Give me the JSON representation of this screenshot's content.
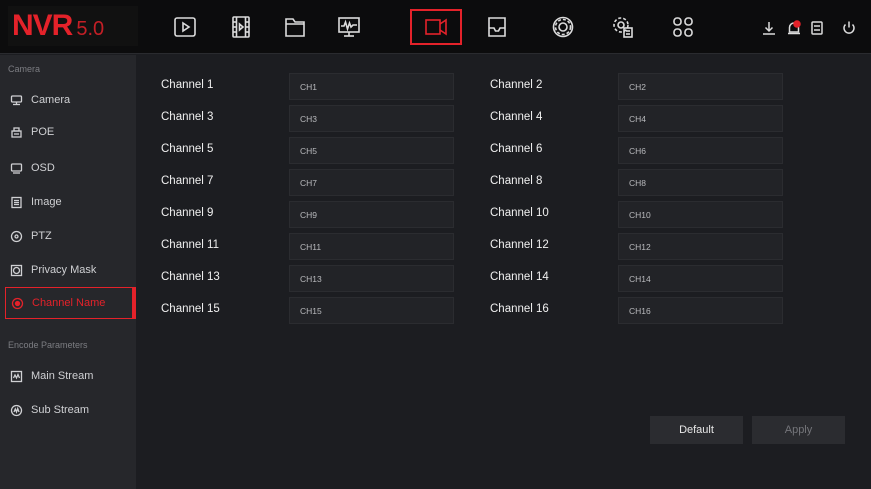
{
  "logo": {
    "brand": "NVR",
    "version": "5.0",
    "accent": "#e4222a"
  },
  "nav": [
    {
      "name": "playback-icon"
    },
    {
      "name": "video-clip-icon"
    },
    {
      "name": "folder-icon"
    },
    {
      "name": "monitor-waveform-icon"
    },
    {
      "name": "camera-icon",
      "active": true
    },
    {
      "name": "storage-icon"
    },
    {
      "name": "settings-icon"
    },
    {
      "name": "advanced-settings-icon"
    },
    {
      "name": "apps-grid-icon"
    }
  ],
  "tools": [
    "download-icon",
    "alarm-bell-icon",
    "backup-disk-icon",
    "power-icon"
  ],
  "sidebar": {
    "section_camera": "Camera",
    "section_encode": "Encode Parameters",
    "items": [
      {
        "label": "Camera",
        "icon": "camera-icon"
      },
      {
        "label": "POE",
        "icon": "poe-icon"
      },
      {
        "label": "OSD",
        "icon": "osd-icon"
      },
      {
        "label": "Image",
        "icon": "image-icon"
      },
      {
        "label": "PTZ",
        "icon": "ptz-icon"
      },
      {
        "label": "Privacy Mask",
        "icon": "privacy-mask-icon"
      },
      {
        "label": "Channel Name",
        "icon": "channel-name-icon",
        "active": true
      },
      {
        "label": "Main Stream",
        "icon": "main-stream-icon"
      },
      {
        "label": "Sub Stream",
        "icon": "sub-stream-icon"
      }
    ]
  },
  "channels": [
    {
      "label": "Channel 1",
      "value": "CH1"
    },
    {
      "label": "Channel 2",
      "value": "CH2"
    },
    {
      "label": "Channel 3",
      "value": "CH3"
    },
    {
      "label": "Channel 4",
      "value": "CH4"
    },
    {
      "label": "Channel 5",
      "value": "CH5"
    },
    {
      "label": "Channel 6",
      "value": "CH6"
    },
    {
      "label": "Channel 7",
      "value": "CH7"
    },
    {
      "label": "Channel 8",
      "value": "CH8"
    },
    {
      "label": "Channel 9",
      "value": "CH9"
    },
    {
      "label": "Channel 10",
      "value": "CH10"
    },
    {
      "label": "Channel 11",
      "value": "CH11"
    },
    {
      "label": "Channel 12",
      "value": "CH12"
    },
    {
      "label": "Channel 13",
      "value": "CH13"
    },
    {
      "label": "Channel 14",
      "value": "CH14"
    },
    {
      "label": "Channel 15",
      "value": "CH15"
    },
    {
      "label": "Channel 16",
      "value": "CH16"
    }
  ],
  "buttons": {
    "default": "Default",
    "apply": "Apply"
  }
}
